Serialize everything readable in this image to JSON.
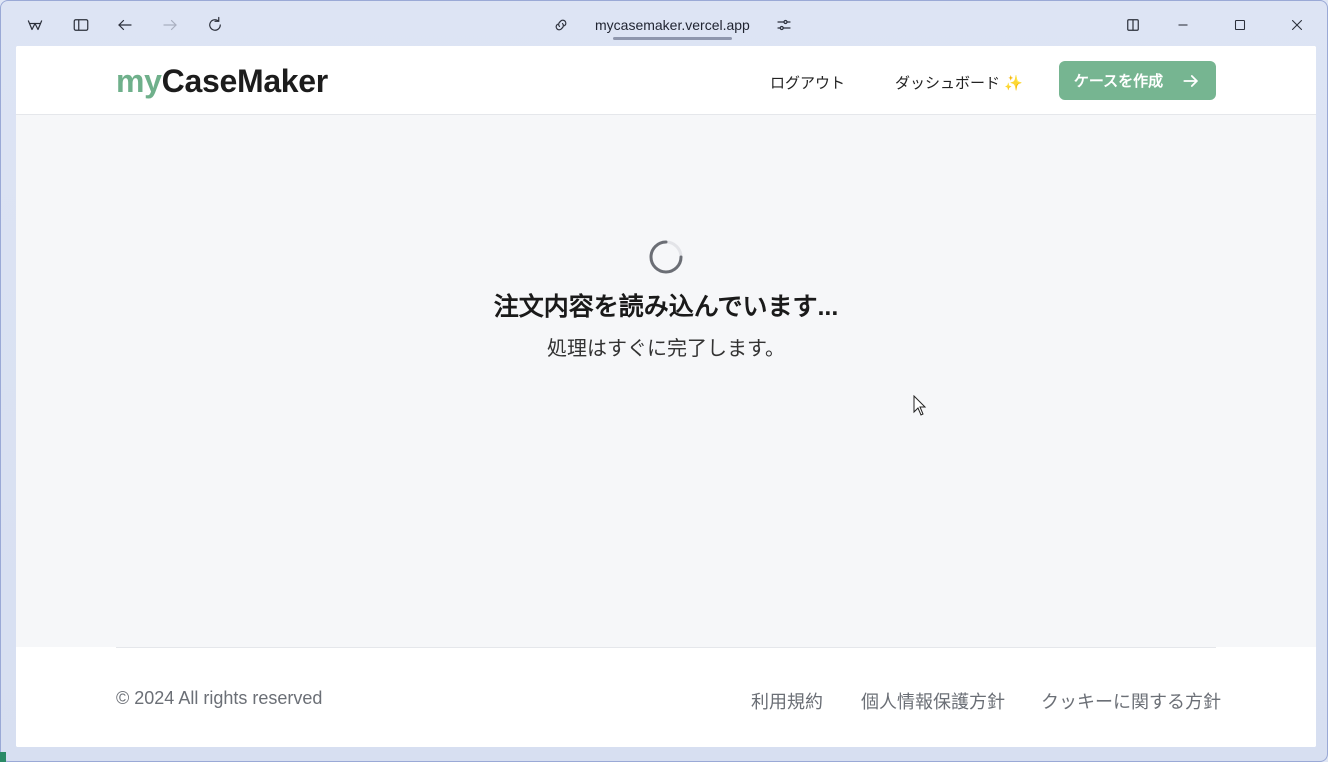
{
  "browser": {
    "url": "mycasemaker.vercel.app",
    "icons": [
      "app-logo-icon",
      "sidebar-toggle-icon",
      "back-arrow-icon",
      "forward-arrow-icon",
      "reload-icon",
      "link-icon",
      "site-settings-icon",
      "split-view-icon",
      "minimize-icon",
      "maximize-icon",
      "close-icon"
    ]
  },
  "header": {
    "logo_accent": "my",
    "logo_main": "CaseMaker",
    "logout": "ログアウト",
    "dashboard": "ダッシュボード ✨",
    "cta_label": "ケースを作成",
    "accent_color": "#76b591"
  },
  "main": {
    "title": "注文内容を読み込んでいます...",
    "subtitle": "処理はすぐに完了します。"
  },
  "footer": {
    "copyright": "© 2024 All rights reserved",
    "links": [
      "利用規約",
      "個人情報保護方針",
      "クッキーに関する方針"
    ]
  }
}
